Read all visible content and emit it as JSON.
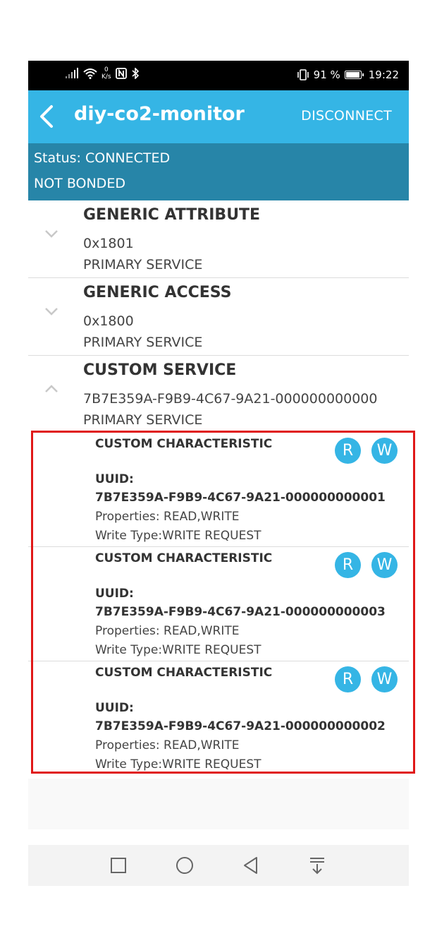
{
  "status_bar": {
    "net_speed_value": "0",
    "net_speed_unit": "K/s",
    "battery_percent": "91 %",
    "time": "19:22"
  },
  "app_bar": {
    "title": "diy-co2-monitor",
    "disconnect_label": "DISCONNECT"
  },
  "connection": {
    "status": "Status: CONNECTED",
    "bond": "NOT BONDED"
  },
  "services": [
    {
      "name": "GENERIC ATTRIBUTE",
      "uuid": "0x1801",
      "type": "PRIMARY SERVICE",
      "expanded": false
    },
    {
      "name": "GENERIC ACCESS",
      "uuid": "0x1800",
      "type": "PRIMARY SERVICE",
      "expanded": false
    },
    {
      "name": "CUSTOM SERVICE",
      "uuid": "7B7E359A-F9B9-4C67-9A21-000000000000",
      "type": "PRIMARY SERVICE",
      "expanded": true
    }
  ],
  "characteristics": [
    {
      "name": "CUSTOM CHARACTERISTIC",
      "uuid_label": "UUID:",
      "uuid": "7B7E359A-F9B9-4C67-9A21-000000000001",
      "properties": "Properties: READ,WRITE",
      "write_type": "Write Type:WRITE REQUEST",
      "read_button": "R",
      "write_button": "W"
    },
    {
      "name": "CUSTOM CHARACTERISTIC",
      "uuid_label": "UUID:",
      "uuid": "7B7E359A-F9B9-4C67-9A21-000000000003",
      "properties": "Properties: READ,WRITE",
      "write_type": "Write Type:WRITE REQUEST",
      "read_button": "R",
      "write_button": "W"
    },
    {
      "name": "CUSTOM CHARACTERISTIC",
      "uuid_label": "UUID:",
      "uuid": "7B7E359A-F9B9-4C67-9A21-000000000002",
      "properties": "Properties: READ,WRITE",
      "write_type": "Write Type:WRITE REQUEST",
      "read_button": "R",
      "write_button": "W"
    }
  ],
  "colors": {
    "accent": "#35b5e5",
    "status_bg": "#2785a8",
    "highlight": "#e01818"
  },
  "nav_icons": [
    "recents-square-icon",
    "home-circle-icon",
    "back-triangle-icon",
    "notification-pull-icon"
  ]
}
